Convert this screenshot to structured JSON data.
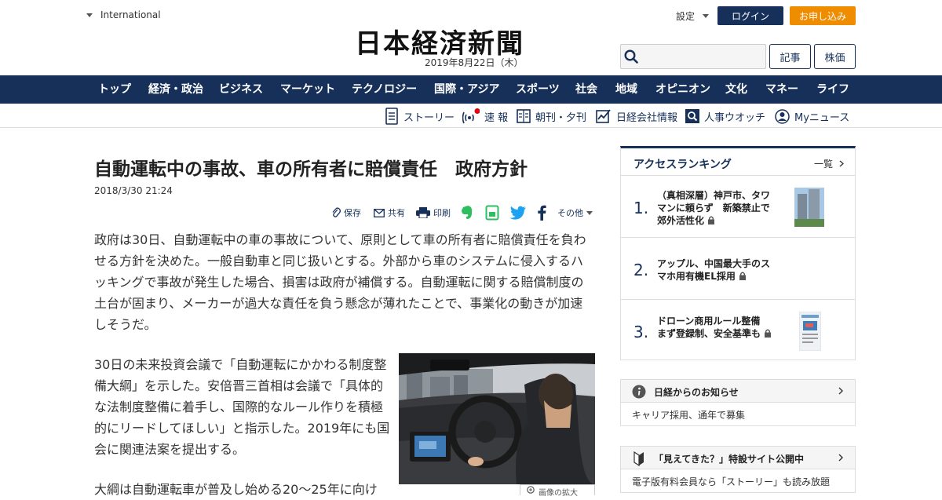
{
  "header": {
    "international": "International",
    "logo": "日本経済新聞",
    "date": "2019年8月22日（木）",
    "settings": "設定",
    "login": "ログイン",
    "subscribe": "お申し込み",
    "search_placeholder": "",
    "articles_button": "記事",
    "stocks_button": "株価"
  },
  "nav": {
    "items": [
      "トップ",
      "経済・政治",
      "ビジネス",
      "マーケット",
      "テクノロジー",
      "国際・アジア",
      "スポーツ",
      "社会",
      "地域",
      "オピニオン",
      "文化",
      "マネー",
      "ライフ"
    ]
  },
  "subnav": {
    "items": [
      "ストーリー",
      "速 報",
      "朝刊・夕刊",
      "日経会社情報",
      "人事ウオッチ",
      "Myニュース"
    ]
  },
  "article": {
    "title": "自動運転中の事故、車の所有者に賠償責任　政府方針",
    "date": "2018/3/30 21:24",
    "tools": {
      "save": "保存",
      "share": "共有",
      "print": "印刷",
      "more": "その他"
    },
    "lead": "政府は30日、自動運転中の車の事故について、原則として車の所有者に賠償責任を負わせる方針を決めた。一般自動車と同じ扱いとする。外部から車のシステムに侵入するハッキングで事故が発生した場合、損害は政府が補償する。自動運転に関する賠償制度の土台が固まり、メーカーが過大な責任を負う懸念が薄れたことで、事業化の動きが加速しそうだ。",
    "para2": "30日の未来投資会議で「自動運転にかかわる制度整備大綱」を示した。安倍晋三首相は会議で「具体的な法制度整備に着手し、国際的なルール作りを積極的にリードしてほしい」と指示した。2019年にも国会に関連法案を提出する。",
    "para3": "大綱は自動運転車が普及し始める20～25年に向け",
    "zoom": "画像の拡大"
  },
  "ranking": {
    "title": "アクセスランキング",
    "more": "一覧",
    "items": [
      {
        "num": "1.",
        "text": "（真相深層）神戸市、タワマンに頼らず　新築禁止で郊外活性化"
      },
      {
        "num": "2.",
        "text": "アップル、中国最大手のスマホ用有機EL採用"
      },
      {
        "num": "3.",
        "text": "ドローン商用ルール整備　まず登録制、安全基準も"
      }
    ]
  },
  "notices": [
    {
      "title": "日経からのお知らせ",
      "body": "キャリア採用、通年で募集"
    },
    {
      "title": "「見えてきた？」特設サイト公開中",
      "body": "電子版有料会員なら「ストーリー」も読み放題"
    }
  ],
  "colors": {
    "brand_navy": "#16305a",
    "accent_orange": "#f08c00",
    "alert_red": "#e60012"
  }
}
